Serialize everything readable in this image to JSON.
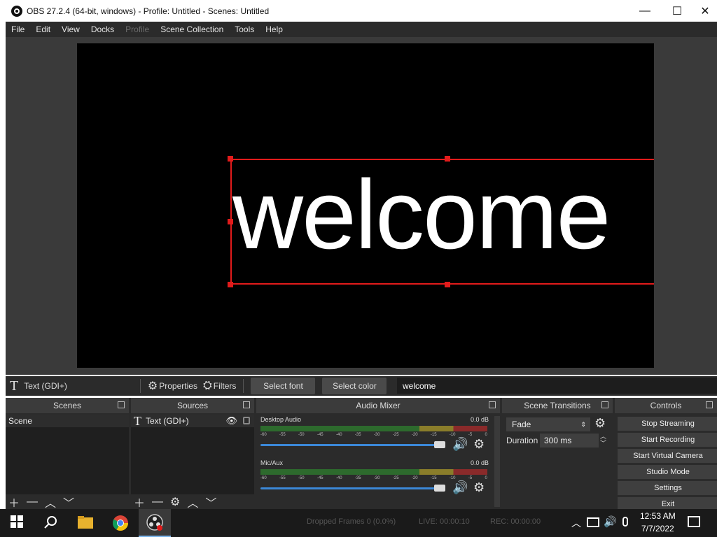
{
  "window": {
    "title": "OBS 27.2.4 (64-bit, windows) - Profile: Untitled - Scenes: Untitled",
    "minimize": "—",
    "maximize": "☐",
    "close": "✕"
  },
  "menu": [
    "File",
    "Edit",
    "View",
    "Docks",
    "Profile",
    "Scene Collection",
    "Tools",
    "Help"
  ],
  "preview": {
    "text": "welcome",
    "selection_color": "#e21b1b"
  },
  "properties_bar": {
    "source_icon": "T",
    "source_name": "Text (GDI+)",
    "properties": "Properties",
    "filters": "Filters",
    "select_font": "Select font",
    "select_color": "Select color",
    "text_value": "welcome"
  },
  "scenes": {
    "title": "Scenes",
    "items": [
      "Scene"
    ]
  },
  "sources": {
    "title": "Sources",
    "items": [
      {
        "icon": "T",
        "name": "Text (GDI+)"
      }
    ]
  },
  "mixer": {
    "title": "Audio Mixer",
    "ticks": [
      "-60",
      "-55",
      "-50",
      "-45",
      "-40",
      "-35",
      "-30",
      "-25",
      "-20",
      "-15",
      "-10",
      "-5",
      "0"
    ],
    "channels": [
      {
        "name": "Desktop Audio",
        "db": "0.0 dB",
        "volume": 1.0
      },
      {
        "name": "Mic/Aux",
        "db": "0.0 dB",
        "volume": 1.0
      }
    ]
  },
  "transitions": {
    "title": "Scene Transitions",
    "type": "Fade",
    "duration_label": "Duration",
    "duration_value": "300 ms"
  },
  "controls": {
    "title": "Controls",
    "buttons": [
      "Stop Streaming",
      "Start Recording",
      "Start Virtual Camera",
      "Studio Mode",
      "Settings",
      "Exit"
    ]
  },
  "status_ghost": {
    "dropped": "Dropped Frames 0 (0.0%)",
    "live": "LIVE: 00:00:10",
    "rec": "REC: 00:00:00"
  },
  "taskbar": {
    "time": "12:53 AM",
    "date": "7/7/2022"
  }
}
